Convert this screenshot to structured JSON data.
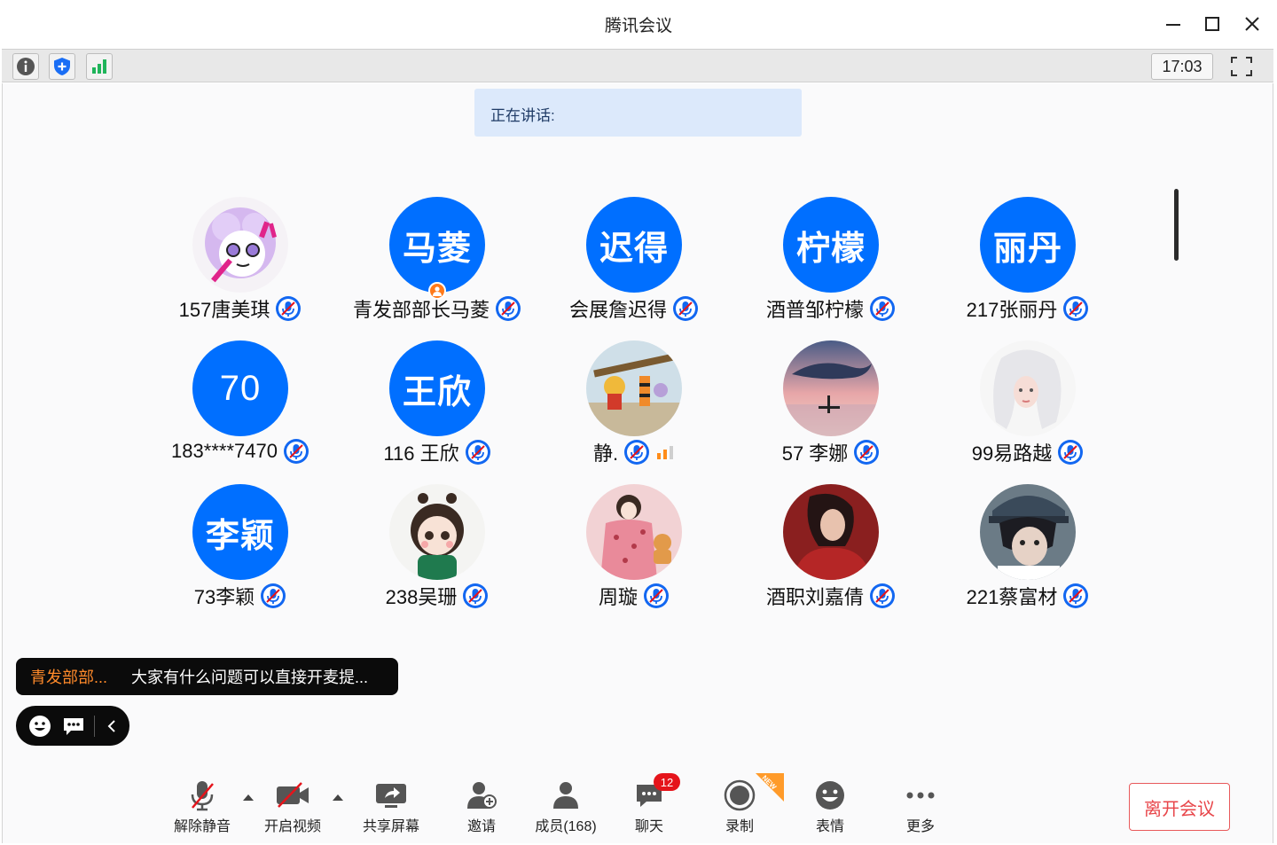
{
  "window": {
    "title": "腾讯会议"
  },
  "toolbar": {
    "icons": [
      "info-icon",
      "shield-icon",
      "signal-icon"
    ],
    "clock": "17:03"
  },
  "speaking": {
    "label": "正在讲话:"
  },
  "participants": [
    {
      "name": "157唐美琪",
      "avatar_text": "",
      "avatar_kind": "image-cartoon-girl",
      "muted": true
    },
    {
      "name": "青发部部长马菱",
      "avatar_text": "马菱",
      "avatar_kind": "text",
      "muted": true,
      "host": true
    },
    {
      "name": "会展詹迟得",
      "avatar_text": "迟得",
      "avatar_kind": "text",
      "muted": true
    },
    {
      "name": "酒普邹柠檬",
      "avatar_text": "柠檬",
      "avatar_kind": "text",
      "muted": true
    },
    {
      "name": "217张丽丹",
      "avatar_text": "丽丹",
      "avatar_kind": "text",
      "muted": true
    },
    {
      "name": "183****7470",
      "avatar_text": "70",
      "avatar_kind": "text",
      "muted": true
    },
    {
      "name": "116 王欣",
      "avatar_text": "王欣",
      "avatar_kind": "text",
      "muted": true
    },
    {
      "name": "静.",
      "avatar_text": "",
      "avatar_kind": "image-cartoon-animals",
      "muted": true,
      "weak_signal": true
    },
    {
      "name": "57 李娜",
      "avatar_text": "",
      "avatar_kind": "image-whale-sunset",
      "muted": true
    },
    {
      "name": "99易路越",
      "avatar_text": "",
      "avatar_kind": "image-white-hair-girl",
      "muted": true
    },
    {
      "name": "73李颖",
      "avatar_text": "李颖",
      "avatar_kind": "text",
      "muted": true
    },
    {
      "name": "238吴珊",
      "avatar_text": "",
      "avatar_kind": "image-chibi-girl",
      "muted": true
    },
    {
      "name": "周璇",
      "avatar_text": "",
      "avatar_kind": "image-pink-pajama-girl",
      "muted": true
    },
    {
      "name": "酒职刘嘉倩",
      "avatar_text": "",
      "avatar_kind": "image-red-portrait",
      "muted": true
    },
    {
      "name": "221蔡富材",
      "avatar_text": "",
      "avatar_kind": "image-anime-boy-cap",
      "muted": true
    }
  ],
  "chat_toast": {
    "sender": "青发部部...",
    "message": "大家有什么问题可以直接开麦提..."
  },
  "controls": {
    "unmute": "解除静音",
    "video": "开启视频",
    "share": "共享屏幕",
    "invite": "邀请",
    "members": "成员(168)",
    "chat": "聊天",
    "chat_badge": "12",
    "record": "录制",
    "record_ribbon": "NEW",
    "reactions": "表情",
    "more": "更多",
    "leave": "离开会议"
  },
  "colors": {
    "accent_blue": "#006fff",
    "leave_red": "#e8464a",
    "speaking_bg": "#dce9fb",
    "badge_red": "#e5141b"
  }
}
